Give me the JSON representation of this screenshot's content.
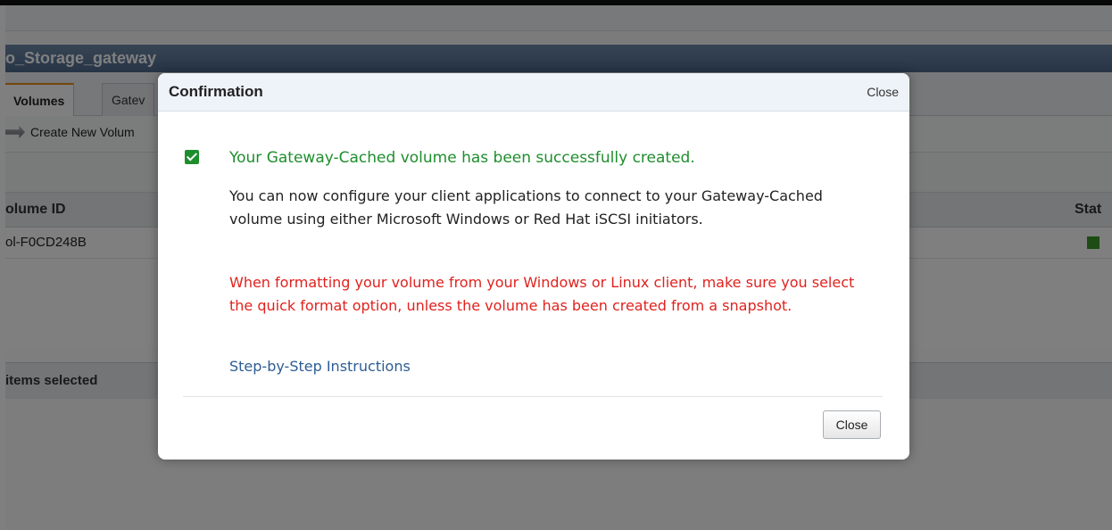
{
  "app": {
    "gateway_name": "o_Storage_gateway",
    "tabs": [
      {
        "label": "Volumes",
        "active": true
      },
      {
        "label": "Gatev",
        "active": false
      }
    ],
    "toolbar": {
      "create_label": "Create New Volum"
    },
    "table": {
      "headers": {
        "volume_id": "olume ID",
        "status": "Stat"
      },
      "rows": [
        {
          "volume_id": "ol-F0CD248B",
          "status_color": "#3a9a2a"
        }
      ]
    },
    "selection": {
      "label": "items selected"
    }
  },
  "modal": {
    "title": "Confirmation",
    "header_close": "Close",
    "success_message": "Your Gateway-Cached volume has been successfully created.",
    "info_message": "You can now configure your client applications to connect to your Gateway-Cached volume using either Microsoft Windows or Red Hat iSCSI initiators.",
    "warning_message": "When formatting your volume from your Windows or Linux client, make sure you select the quick format option, unless the volume has been created from a snapshot.",
    "instructions_link": "Step-by-Step Instructions",
    "close_button": "Close"
  },
  "colors": {
    "success": "#1e8e2d",
    "warning": "#e0221e",
    "link": "#2c5d92",
    "header_bar": "#5a7699",
    "tab_accent": "#e48c1b"
  },
  "icons": [
    "create-volume-icon",
    "check-icon",
    "status-icon"
  ]
}
